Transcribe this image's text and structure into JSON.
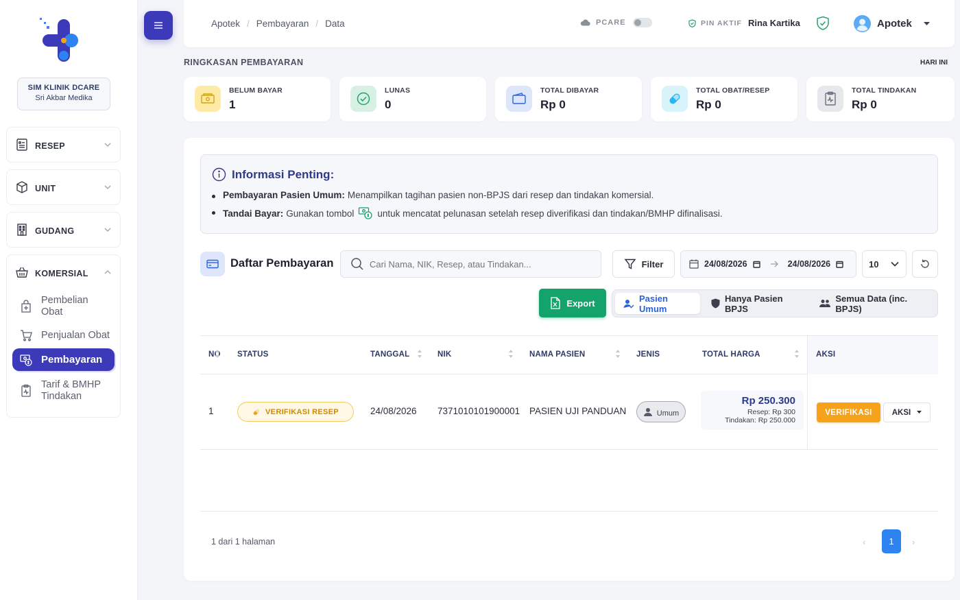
{
  "sidebar": {
    "clinic_name": "SIM KLINIK DCARE",
    "clinic_sub": "Sri Akbar Medika",
    "menus": [
      {
        "label": "RESEP",
        "icon": "receipt-icon"
      },
      {
        "label": "UNIT",
        "icon": "box-icon"
      },
      {
        "label": "GUDANG",
        "icon": "building-icon"
      },
      {
        "label": "KOMERSIAL",
        "icon": "basket-icon"
      }
    ],
    "sub_items": [
      {
        "label": "Pembelian Obat",
        "icon": "bag-plus-icon"
      },
      {
        "label": "Penjualan Obat",
        "icon": "cart-icon"
      },
      {
        "label": "Pembayaran",
        "icon": "money-icon",
        "active": true
      },
      {
        "label": "Tarif & BMHP Tindakan",
        "icon": "clipboard-pulse-icon"
      }
    ]
  },
  "topbar": {
    "breadcrumb": [
      "Apotek",
      "Pembayaran",
      "Data"
    ],
    "pcare_label": "PCARE",
    "pin_label": "PIN AKTIF",
    "pin_user": "Rina Kartika",
    "user_role": "Apotek"
  },
  "summary": {
    "title": "RINGKASAN PEMBAYARAN",
    "period": "HARI INI",
    "cards": [
      {
        "label": "BELUM BAYAR",
        "value": "1",
        "color": "#fdeaa7"
      },
      {
        "label": "LUNAS",
        "value": "0",
        "color": "#d8efe4"
      },
      {
        "label": "TOTAL DIBAYAR",
        "value": "Rp 0",
        "color": "#dde6fa"
      },
      {
        "label": "TOTAL OBAT/RESEP",
        "value": "Rp 0",
        "color": "#d8f3fa"
      },
      {
        "label": "TOTAL TINDAKAN",
        "value": "Rp 0",
        "color": "#e6e8ec"
      }
    ]
  },
  "info": {
    "title": "Informasi Penting:",
    "item1_bold": "Pembayaran Pasien Umum:",
    "item1_text": "Menampilkan tagihan pasien non-BPJS dari resep dan tindakan komersial.",
    "item2_bold": "Tandai Bayar:",
    "item2_pre": "Gunakan tombol",
    "item2_post": "untuk mencatat pelunasan setelah resep diverifikasi dan tindakan/BMHP difinalisasi."
  },
  "list": {
    "title": "Daftar Pembayaran",
    "search_placeholder": "Cari Nama, NIK, Resep, atau Tindakan...",
    "filter_label": "Filter",
    "date_from": "24/08/2026",
    "date_to": "24/08/2026",
    "per_page": "10",
    "export_label": "Export",
    "segments": [
      "Pasien Umum",
      "Hanya Pasien BPJS",
      "Semua Data (inc. BPJS)"
    ]
  },
  "table": {
    "headers": {
      "no": "NO",
      "status": "STATUS",
      "tanggal": "TANGGAL",
      "nik": "NIK",
      "nama": "NAMA PASIEN",
      "jenis": "JENIS",
      "total": "TOTAL HARGA",
      "aksi": "AKSI"
    },
    "rows": [
      {
        "no": "1",
        "status": "VERIFIKASI RESEP",
        "tanggal": "24/08/2026",
        "nik": "7371010101900001",
        "nama": "PASIEN UJI PANDUAN",
        "jenis": "Umum",
        "total": "Rp 250.300",
        "resep": "Resep: Rp 300",
        "tindakan": "Tindakan: Rp 250.000",
        "verify_label": "VERIFIKASI",
        "aksi_label": "AKSI"
      }
    ]
  },
  "pagination": {
    "info": "1 dari 1 halaman",
    "current": "1",
    "prev": "‹",
    "next": "›"
  }
}
